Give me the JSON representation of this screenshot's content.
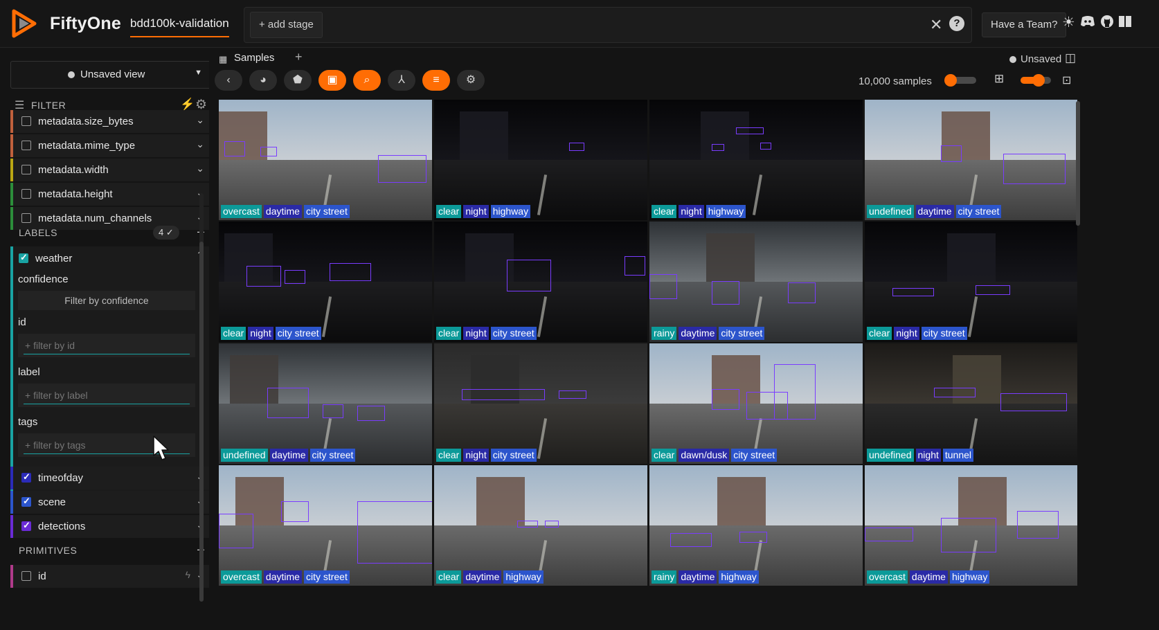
{
  "app": {
    "name": "FiftyOne",
    "dataset": "bdd100k-validation"
  },
  "header": {
    "add_stage": "+ add stage",
    "team_button": "Have a Team?"
  },
  "sidebar": {
    "view_label": "Unsaved view",
    "filter_label": "FILTER",
    "metadata_fields": [
      {
        "label": "metadata.size_bytes",
        "color": "#c0603c"
      },
      {
        "label": "metadata.mime_type",
        "color": "#c0603c"
      },
      {
        "label": "metadata.width",
        "color": "#b9a613"
      },
      {
        "label": "metadata.height",
        "color": "#2c8d3a"
      },
      {
        "label": "metadata.num_channels",
        "color": "#2c8d3a"
      }
    ],
    "labels_section": {
      "title": "LABELS",
      "count": "4 ✓"
    },
    "weather": {
      "label": "weather",
      "color": "#19a3a3",
      "confidence_label": "confidence",
      "confidence_button": "Filter by confidence",
      "id_label": "id",
      "id_placeholder": "+ filter by id",
      "label_label": "label",
      "label_placeholder": "+ filter by label",
      "tags_label": "tags",
      "tags_placeholder": "+ filter by tags"
    },
    "label_fields": [
      {
        "label": "timeofday",
        "color": "#2b2bb8"
      },
      {
        "label": "scene",
        "color": "#2c55cc"
      },
      {
        "label": "detections",
        "color": "#6a2bd6"
      }
    ],
    "primitives_section": {
      "title": "PRIMITIVES"
    },
    "primitive_fields": [
      {
        "label": "id",
        "color": "#b03a8a"
      }
    ]
  },
  "main": {
    "tab_label": "Samples",
    "unsaved_label": "Unsaved",
    "samples_count": "10,000 samples",
    "zoom_level": 0.15,
    "grid_size_level": 0.6
  },
  "samples": [
    {
      "weather": "overcast",
      "timeofday": "daytime",
      "scene": "city street",
      "style": "day"
    },
    {
      "weather": "clear",
      "timeofday": "night",
      "scene": "highway",
      "style": "night"
    },
    {
      "weather": "clear",
      "timeofday": "night",
      "scene": "highway",
      "style": "night"
    },
    {
      "weather": "undefined",
      "timeofday": "daytime",
      "scene": "city street",
      "style": "day"
    },
    {
      "weather": "clear",
      "timeofday": "night",
      "scene": "city street",
      "style": "night"
    },
    {
      "weather": "clear",
      "timeofday": "night",
      "scene": "city street",
      "style": "night"
    },
    {
      "weather": "rainy",
      "timeofday": "daytime",
      "scene": "city street",
      "style": "under"
    },
    {
      "weather": "clear",
      "timeofday": "night",
      "scene": "city street",
      "style": "night"
    },
    {
      "weather": "undefined",
      "timeofday": "daytime",
      "scene": "city street",
      "style": "under"
    },
    {
      "weather": "clear",
      "timeofday": "night",
      "scene": "city street",
      "style": "garage"
    },
    {
      "weather": "clear",
      "timeofday": "dawn/dusk",
      "scene": "city street",
      "style": "day"
    },
    {
      "weather": "undefined",
      "timeofday": "night",
      "scene": "tunnel",
      "style": "tunnel"
    },
    {
      "weather": "overcast",
      "timeofday": "daytime",
      "scene": "city street",
      "style": "day"
    },
    {
      "weather": "clear",
      "timeofday": "daytime",
      "scene": "highway",
      "style": "day"
    },
    {
      "weather": "rainy",
      "timeofday": "daytime",
      "scene": "highway",
      "style": "day"
    },
    {
      "weather": "overcast",
      "timeofday": "daytime",
      "scene": "highway",
      "style": "day"
    }
  ]
}
